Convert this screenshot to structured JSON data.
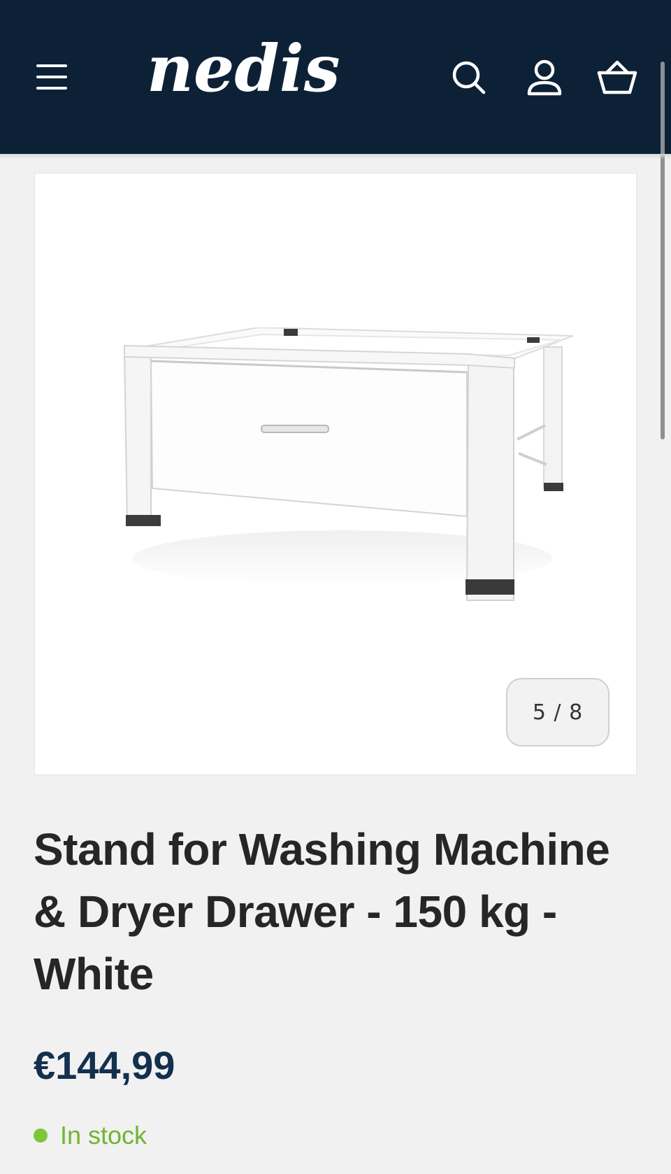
{
  "header": {
    "logo_text": "nedis",
    "background_color": "#0d2136",
    "icons": {
      "menu": "hamburger-menu-icon",
      "search": "search-icon",
      "account": "user-icon",
      "cart": "basket-icon"
    }
  },
  "gallery": {
    "image_alt": "Stand for Washing Machine & Dryer Drawer - 150 kg - White",
    "counter": "5 / 8"
  },
  "product": {
    "title": "Stand for Washing Machine & Dryer Drawer - 150 kg - White",
    "price": "€144,99",
    "stock_status": "In stock",
    "stock_color": "#7cc63a",
    "price_color": "#13304e"
  }
}
